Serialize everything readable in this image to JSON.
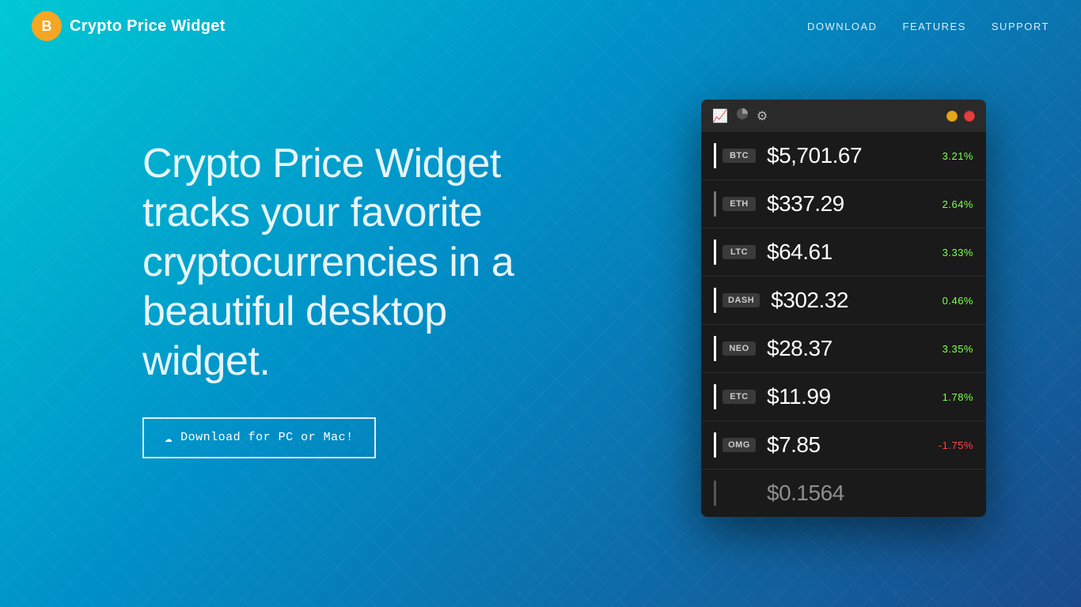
{
  "nav": {
    "logo": {
      "symbol": "B",
      "title": "Crypto Price Widget"
    },
    "links": [
      {
        "label": "DOWNLOAD",
        "href": "#"
      },
      {
        "label": "FEATURES",
        "href": "#"
      },
      {
        "label": "SUPPORT",
        "href": "#"
      }
    ]
  },
  "hero": {
    "headline": "Crypto Price Widget tracks your favorite cryptocurrencies in a beautiful desktop widget.",
    "download_button": "Download for PC or Mac!"
  },
  "widget": {
    "titlebar_icons": [
      "📈",
      "🥧",
      "⚙"
    ],
    "window_buttons": [
      "yellow",
      "red"
    ],
    "cryptos": [
      {
        "symbol": "BTC",
        "price": "$5,701.67",
        "change": "3.21%",
        "positive": true
      },
      {
        "symbol": "ETH",
        "price": "$337.29",
        "change": "2.64%",
        "positive": true
      },
      {
        "symbol": "LTC",
        "price": "$64.61",
        "change": "3.33%",
        "positive": true
      },
      {
        "symbol": "DASH",
        "price": "$302.32",
        "change": "0.46%",
        "positive": true
      },
      {
        "symbol": "NEO",
        "price": "$28.37",
        "change": "3.35%",
        "positive": true
      },
      {
        "symbol": "ETC",
        "price": "$11.99",
        "change": "1.78%",
        "positive": true
      },
      {
        "symbol": "OMG",
        "price": "$7.85",
        "change": "-1.75%",
        "positive": false
      }
    ],
    "partial_price": "$0.1564"
  }
}
